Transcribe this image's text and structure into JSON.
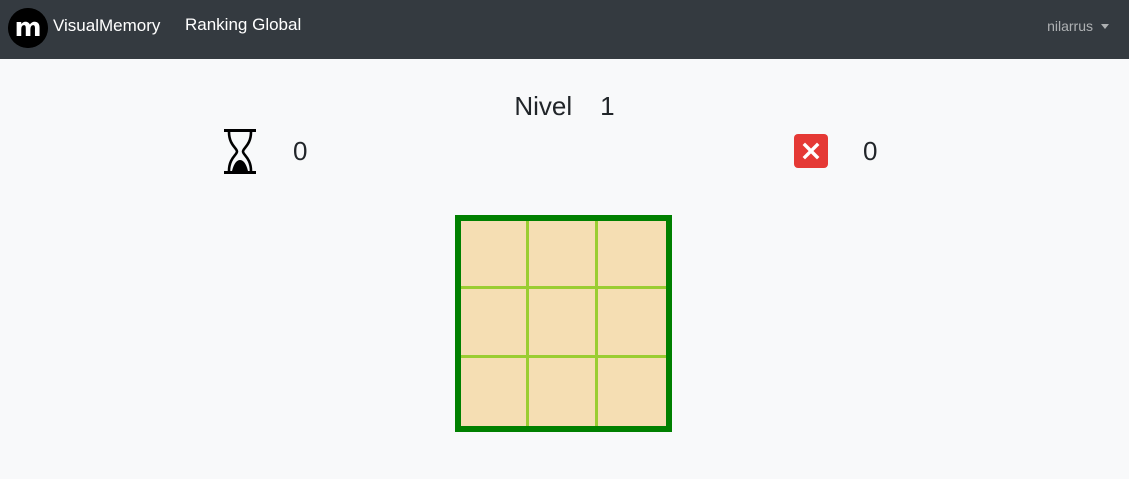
{
  "navbar": {
    "brand": "VisualMemory",
    "logo_letter": "m",
    "links": [
      {
        "label": "Ranking Global"
      }
    ],
    "user": "nilarrus"
  },
  "game": {
    "level_label": "Nivel",
    "level_value": "1",
    "time_value": "0",
    "errors_value": "0",
    "grid_rows": 3,
    "grid_cols": 3
  },
  "colors": {
    "navbar_bg": "#343a40",
    "page_bg": "#f8f9fa",
    "board_border": "#008000",
    "cell_fill": "#f5deb3",
    "cell_lines": "#9acd32",
    "error_icon": "#e53935"
  },
  "icons": {
    "time": "hourglass-icon",
    "errors": "close-icon",
    "user_menu": "caret-down-icon"
  }
}
